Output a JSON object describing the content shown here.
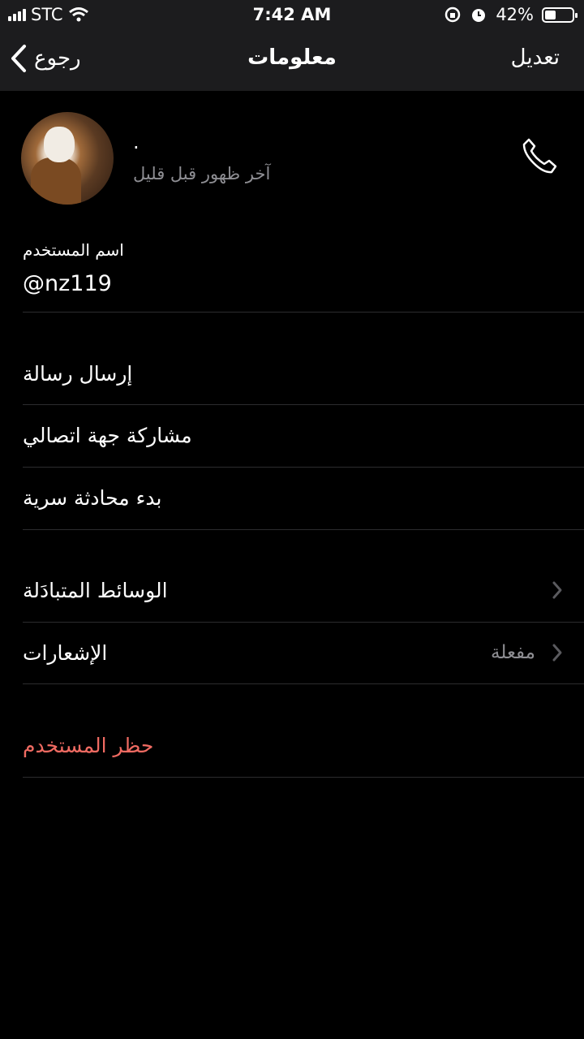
{
  "status_bar": {
    "carrier": "STC",
    "time": "7:42 AM",
    "battery_percent": "42%",
    "battery_level": 0.42
  },
  "nav": {
    "back_label": "رجوع",
    "title": "معلومات",
    "edit_label": "تعديل"
  },
  "profile": {
    "name": "·",
    "last_seen": "آخر ظهور قبل قليل"
  },
  "username": {
    "label": "اسم المستخدم",
    "value": "@nz119"
  },
  "actions": [
    {
      "label": "إرسال رسالة"
    },
    {
      "label": "مشاركة جهة اتصالي"
    },
    {
      "label": "بدء محادثة سرية"
    }
  ],
  "settings": [
    {
      "label": "الوسائط المتبادَلة",
      "value": ""
    },
    {
      "label": "الإشعارات",
      "value": "مفعلة"
    }
  ],
  "block": {
    "label": "حظر المستخدم",
    "color": "#f06b62"
  }
}
